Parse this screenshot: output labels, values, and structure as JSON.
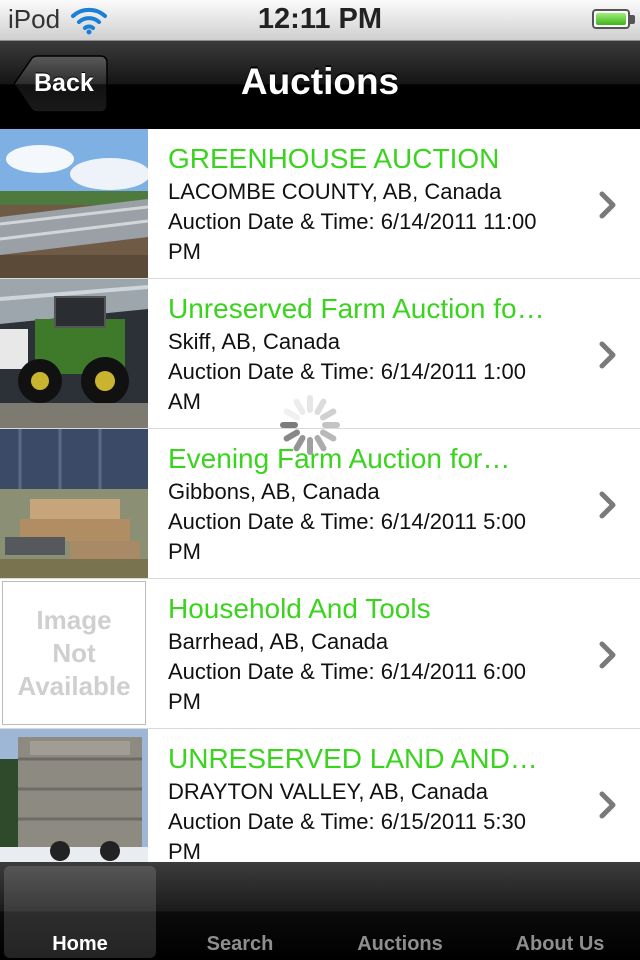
{
  "status_bar": {
    "carrier": "iPod",
    "time": "12:11 PM"
  },
  "nav": {
    "back_label": "Back",
    "title": "Auctions"
  },
  "auctions": [
    {
      "title": "GREENHOUSE AUCTION",
      "location": "LACOMBE COUNTY, AB, Canada",
      "date_line": "Auction Date & Time: 6/14/2011 11:00",
      "date_wrap": "PM"
    },
    {
      "title": "Unreserved Farm Auction fo…",
      "location": "Skiff, AB, Canada",
      "date_line": "Auction Date & Time: 6/14/2011 1:00",
      "date_wrap": "AM"
    },
    {
      "title": "Evening Farm Auction for…",
      "location": "Gibbons, AB, Canada",
      "date_line": "Auction Date & Time: 6/14/2011 5:00",
      "date_wrap": "PM"
    },
    {
      "title": "Household And Tools",
      "location": "Barrhead, AB, Canada",
      "date_line": "Auction Date & Time: 6/14/2011 6:00",
      "date_wrap": "PM",
      "placeholder": [
        "Image",
        "Not",
        "Available"
      ]
    },
    {
      "title": "UNRESERVED LAND AND…",
      "location": "DRAYTON VALLEY, AB, Canada",
      "date_line": "Auction Date & Time: 6/15/2011 5:30",
      "date_wrap": "PM"
    }
  ],
  "tabs": [
    {
      "label": "Home",
      "active": true
    },
    {
      "label": "Search",
      "active": false
    },
    {
      "label": "Auctions",
      "active": false
    },
    {
      "label": "About Us",
      "active": false
    }
  ],
  "colors": {
    "title_green": "#3ad41e"
  }
}
